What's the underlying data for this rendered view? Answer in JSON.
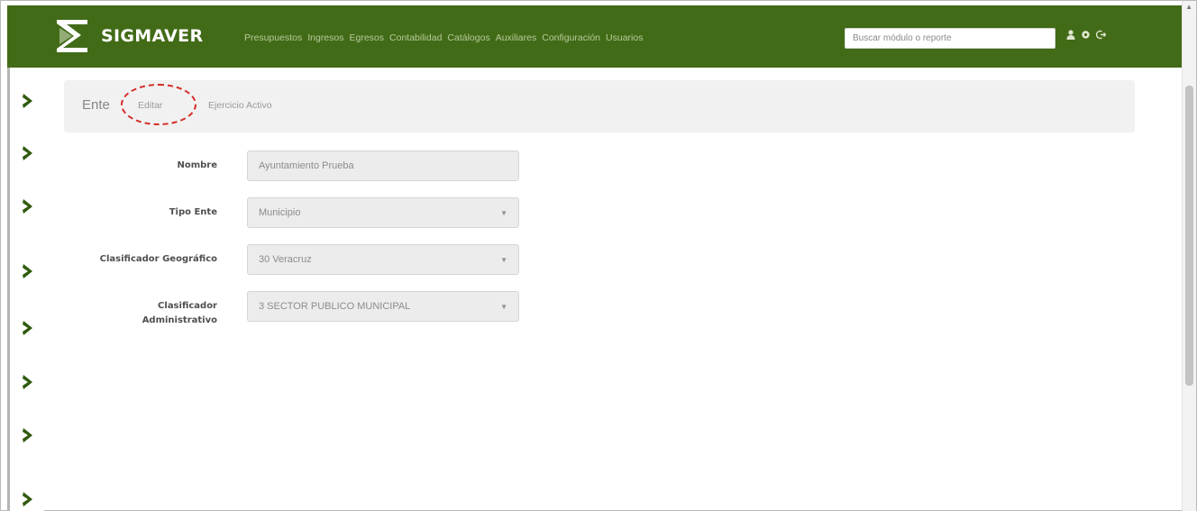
{
  "app": {
    "brand": "SIGMAVER"
  },
  "nav": {
    "items": [
      "Presupuestos",
      "Ingresos",
      "Egresos",
      "Contabilidad",
      "Catálogos",
      "Auxiliares",
      "Configuración",
      "Usuarios"
    ],
    "search_placeholder": "Buscar módulo o reporte",
    "icons": [
      "user-icon",
      "gear-icon",
      "logout-icon"
    ]
  },
  "breadcrumb": {
    "section": "Ente",
    "edit_label": "Editar",
    "active_label": "Ejercicio Activo"
  },
  "form": {
    "nombre_label": "Nombre",
    "nombre_value": "Ayuntamiento Prueba",
    "tipo_label": "Tipo Ente",
    "tipo_value": "Municipio",
    "geo_label": "Clasificador Geográfico",
    "geo_value": "30 Veracruz",
    "admin_label_line1": "Clasificador",
    "admin_label_line2": "Administrativo",
    "admin_value": "3 SECTOR PUBLICO MUNICIPAL"
  },
  "colors": {
    "navbar": "#426b17",
    "chevron": "#2f5a0d",
    "annotation": "#d42a24"
  }
}
